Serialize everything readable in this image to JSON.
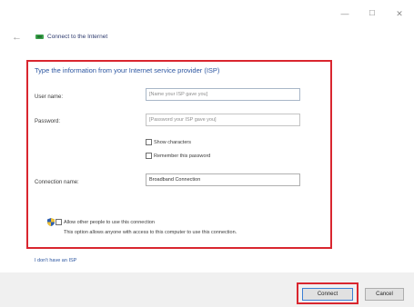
{
  "window": {
    "minimize_glyph": "—",
    "maximize_glyph": "☐",
    "close_glyph": "✕"
  },
  "nav": {
    "back_glyph": "←",
    "title": "Connect to the Internet"
  },
  "form": {
    "heading": "Type the information from your Internet service provider (ISP)",
    "username_label": "User name:",
    "username_placeholder": "[Name your ISP gave you]",
    "password_label": "Password:",
    "password_placeholder": "[Password your ISP gave you]",
    "show_characters": "Show characters",
    "remember_password": "Remember this password",
    "connection_name_label": "Connection name:",
    "connection_name_value": "Broadband Connection",
    "allow_others": "Allow other people to use this connection",
    "allow_others_note": "This option allows anyone with access to this computer to use this connection."
  },
  "links": {
    "isp": "I don't have an ISP"
  },
  "buttons": {
    "connect": "Connect",
    "cancel": "Cancel"
  },
  "colors": {
    "highlight": "#d9262f",
    "link": "#2b55a0",
    "footer": "#f0f0f0"
  }
}
